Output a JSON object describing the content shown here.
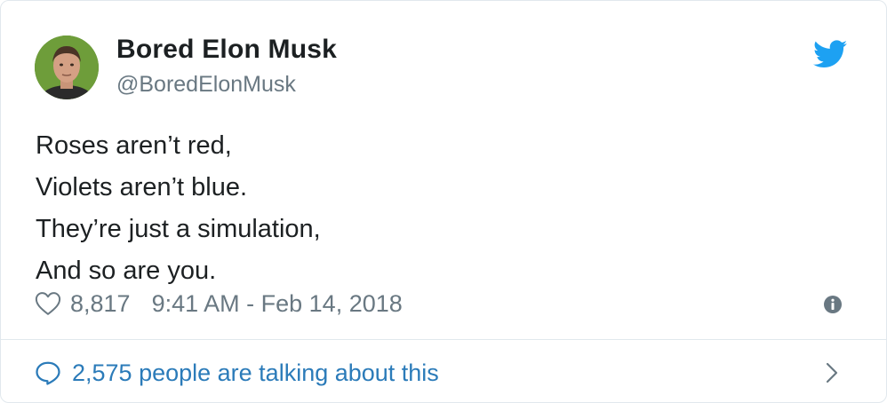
{
  "author": {
    "name": "Bored Elon Musk",
    "handle": "@BoredElonMusk",
    "avatar_icon": "profile-photo"
  },
  "tweet": {
    "lines": [
      "Roses aren’t red,",
      "Violets aren’t blue.",
      "They’re just a simulation,",
      "And so are you."
    ]
  },
  "meta": {
    "likes": "8,817",
    "timestamp": "9:41 AM - Feb 14, 2018"
  },
  "footer": {
    "talking_text": "2,575 people are talking about this"
  },
  "icons": {
    "brand": "twitter-bird-icon",
    "like": "heart-icon",
    "info": "info-icon",
    "reply": "speech-bubble-icon",
    "more": "chevron-right-icon"
  },
  "colors": {
    "twitter_blue": "#1da1f2",
    "link_blue": "#2b7bb9",
    "text": "#1c2022",
    "muted": "#697882",
    "border": "#e1e8ed"
  }
}
